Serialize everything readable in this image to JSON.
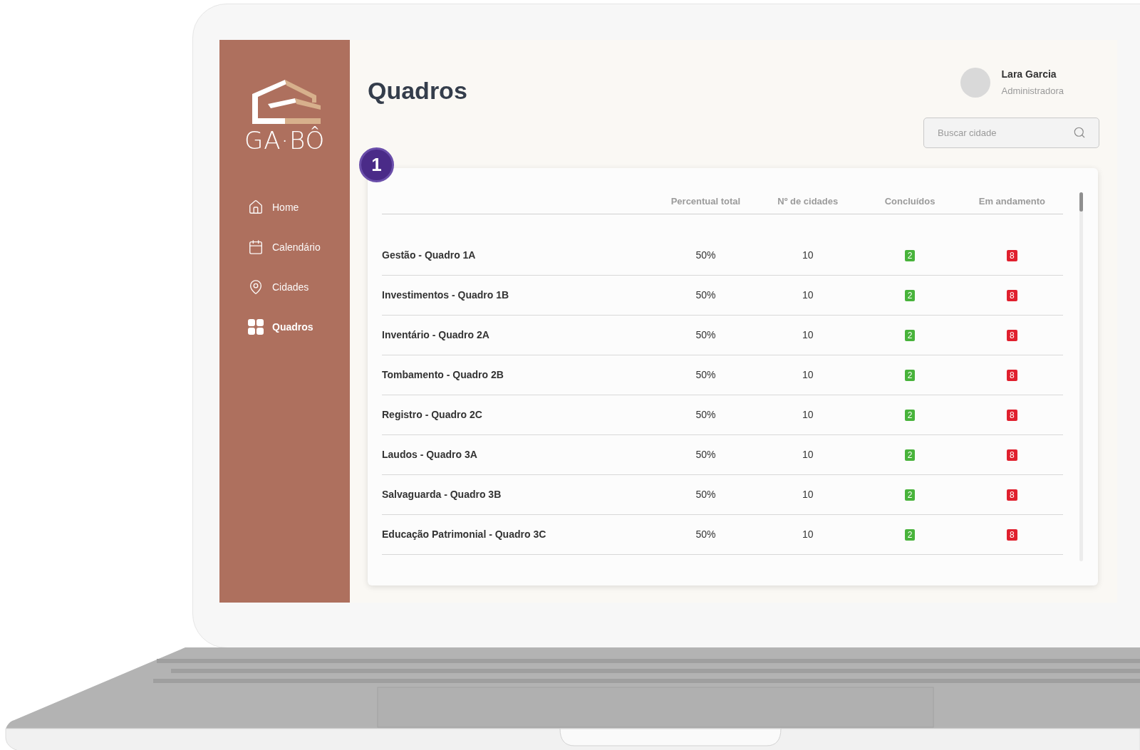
{
  "brand": {
    "name": "GA·BÔ"
  },
  "sidebar": {
    "items": [
      {
        "label": "Home",
        "kind": "home",
        "selected": false
      },
      {
        "label": "Calendário",
        "kind": "calendar",
        "selected": false
      },
      {
        "label": "Cidades",
        "kind": "pin",
        "selected": false
      },
      {
        "label": "Quadros",
        "kind": "grid",
        "selected": true
      }
    ]
  },
  "page": {
    "title": "Quadros"
  },
  "user": {
    "name": "Lara Garcia",
    "role": "Administradora"
  },
  "search": {
    "placeholder": "Buscar cidade"
  },
  "marker": {
    "label": "1"
  },
  "table": {
    "columns": [
      "Percentual total",
      "Nº de cidades",
      "Concluídos",
      "Em andamento"
    ],
    "rows": [
      {
        "name": "Gestão - Quadro 1A",
        "percent": "50%",
        "cities": "10",
        "done": "2",
        "in_progress": "8"
      },
      {
        "name": "Investimentos - Quadro 1B",
        "percent": "50%",
        "cities": "10",
        "done": "2",
        "in_progress": "8"
      },
      {
        "name": "Inventário - Quadro 2A",
        "percent": "50%",
        "cities": "10",
        "done": "2",
        "in_progress": "8"
      },
      {
        "name": "Tombamento - Quadro 2B",
        "percent": "50%",
        "cities": "10",
        "done": "2",
        "in_progress": "8"
      },
      {
        "name": "Registro - Quadro 2C",
        "percent": "50%",
        "cities": "10",
        "done": "2",
        "in_progress": "8"
      },
      {
        "name": "Laudos - Quadro 3A",
        "percent": "50%",
        "cities": "10",
        "done": "2",
        "in_progress": "8"
      },
      {
        "name": "Salvaguarda - Quadro 3B",
        "percent": "50%",
        "cities": "10",
        "done": "2",
        "in_progress": "8"
      },
      {
        "name": "Educação Patrimonial - Quadro 3C",
        "percent": "50%",
        "cities": "10",
        "done": "2",
        "in_progress": "8"
      }
    ]
  }
}
